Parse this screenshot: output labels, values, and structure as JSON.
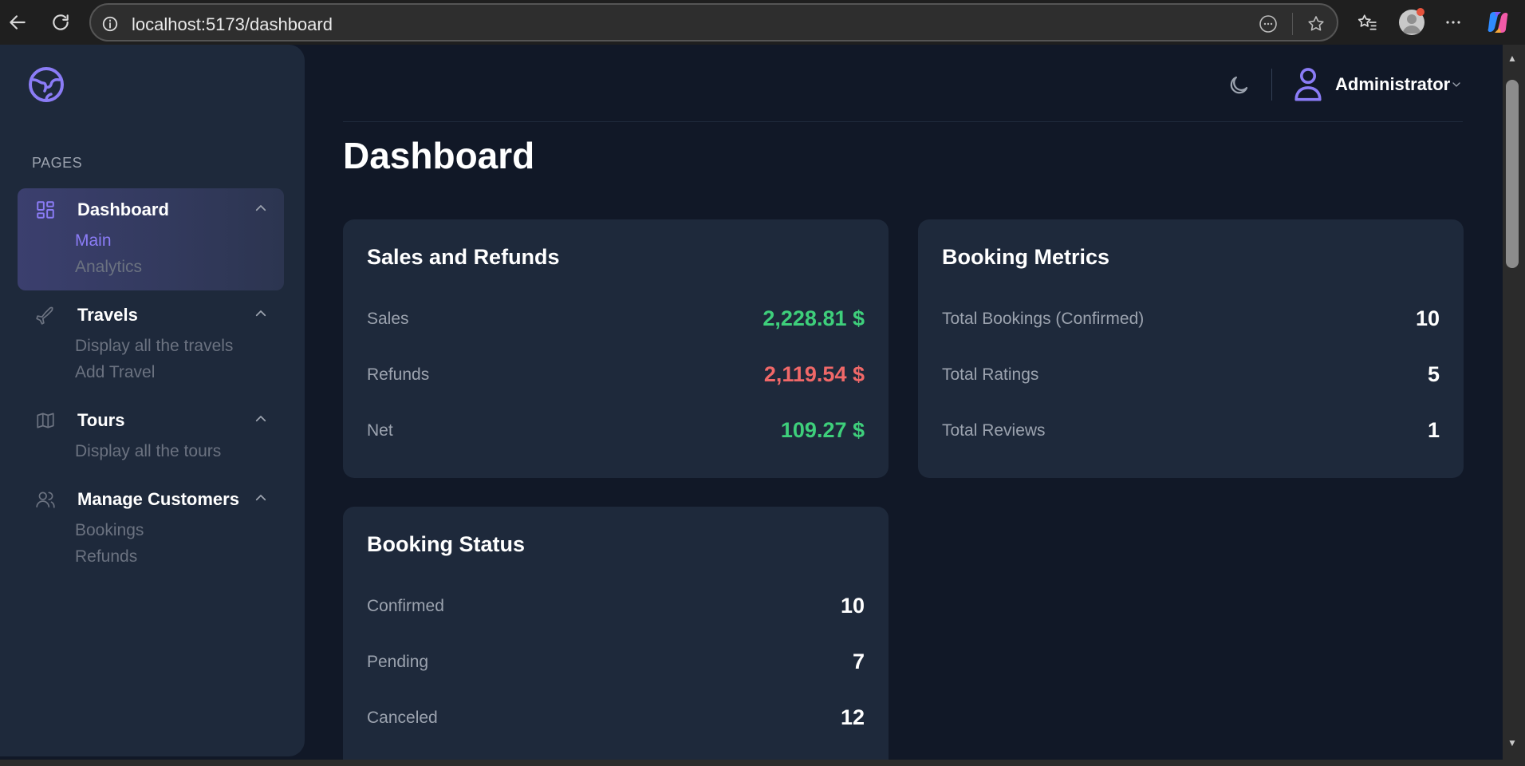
{
  "browser": {
    "url": "localhost:5173/dashboard"
  },
  "sidebar": {
    "section_label": "PAGES",
    "groups": [
      {
        "title": "Dashboard",
        "icon": "grid-icon",
        "items": [
          "Main",
          "Analytics"
        ],
        "active_item": "Main"
      },
      {
        "title": "Travels",
        "icon": "plane-icon",
        "items": [
          "Display all the travels",
          "Add Travel"
        ]
      },
      {
        "title": "Tours",
        "icon": "map-icon",
        "items": [
          "Display all the tours"
        ]
      },
      {
        "title": "Manage Customers",
        "icon": "users-icon",
        "items": [
          "Bookings",
          "Refunds"
        ]
      }
    ]
  },
  "header": {
    "user_name": "Administrator"
  },
  "page": {
    "title": "Dashboard"
  },
  "cards": {
    "sales": {
      "title": "Sales and Refunds",
      "rows": [
        {
          "label": "Sales",
          "value": "2,228.81 $"
        },
        {
          "label": "Refunds",
          "value": "2,119.54 $"
        },
        {
          "label": "Net",
          "value": "109.27 $"
        }
      ]
    },
    "metrics": {
      "title": "Booking Metrics",
      "rows": [
        {
          "label": "Total Bookings (Confirmed)",
          "value": "10"
        },
        {
          "label": "Total Ratings",
          "value": "5"
        },
        {
          "label": "Total Reviews",
          "value": "1"
        }
      ]
    },
    "status": {
      "title": "Booking Status",
      "rows": [
        {
          "label": "Confirmed",
          "value": "10"
        },
        {
          "label": "Pending",
          "value": "7"
        },
        {
          "label": "Canceled",
          "value": "12"
        }
      ]
    }
  },
  "colors": {
    "accent": "#8b7cf6",
    "positive": "#3ecf7b",
    "negative": "#f06868",
    "background": "#111827",
    "card": "#1e293b"
  }
}
